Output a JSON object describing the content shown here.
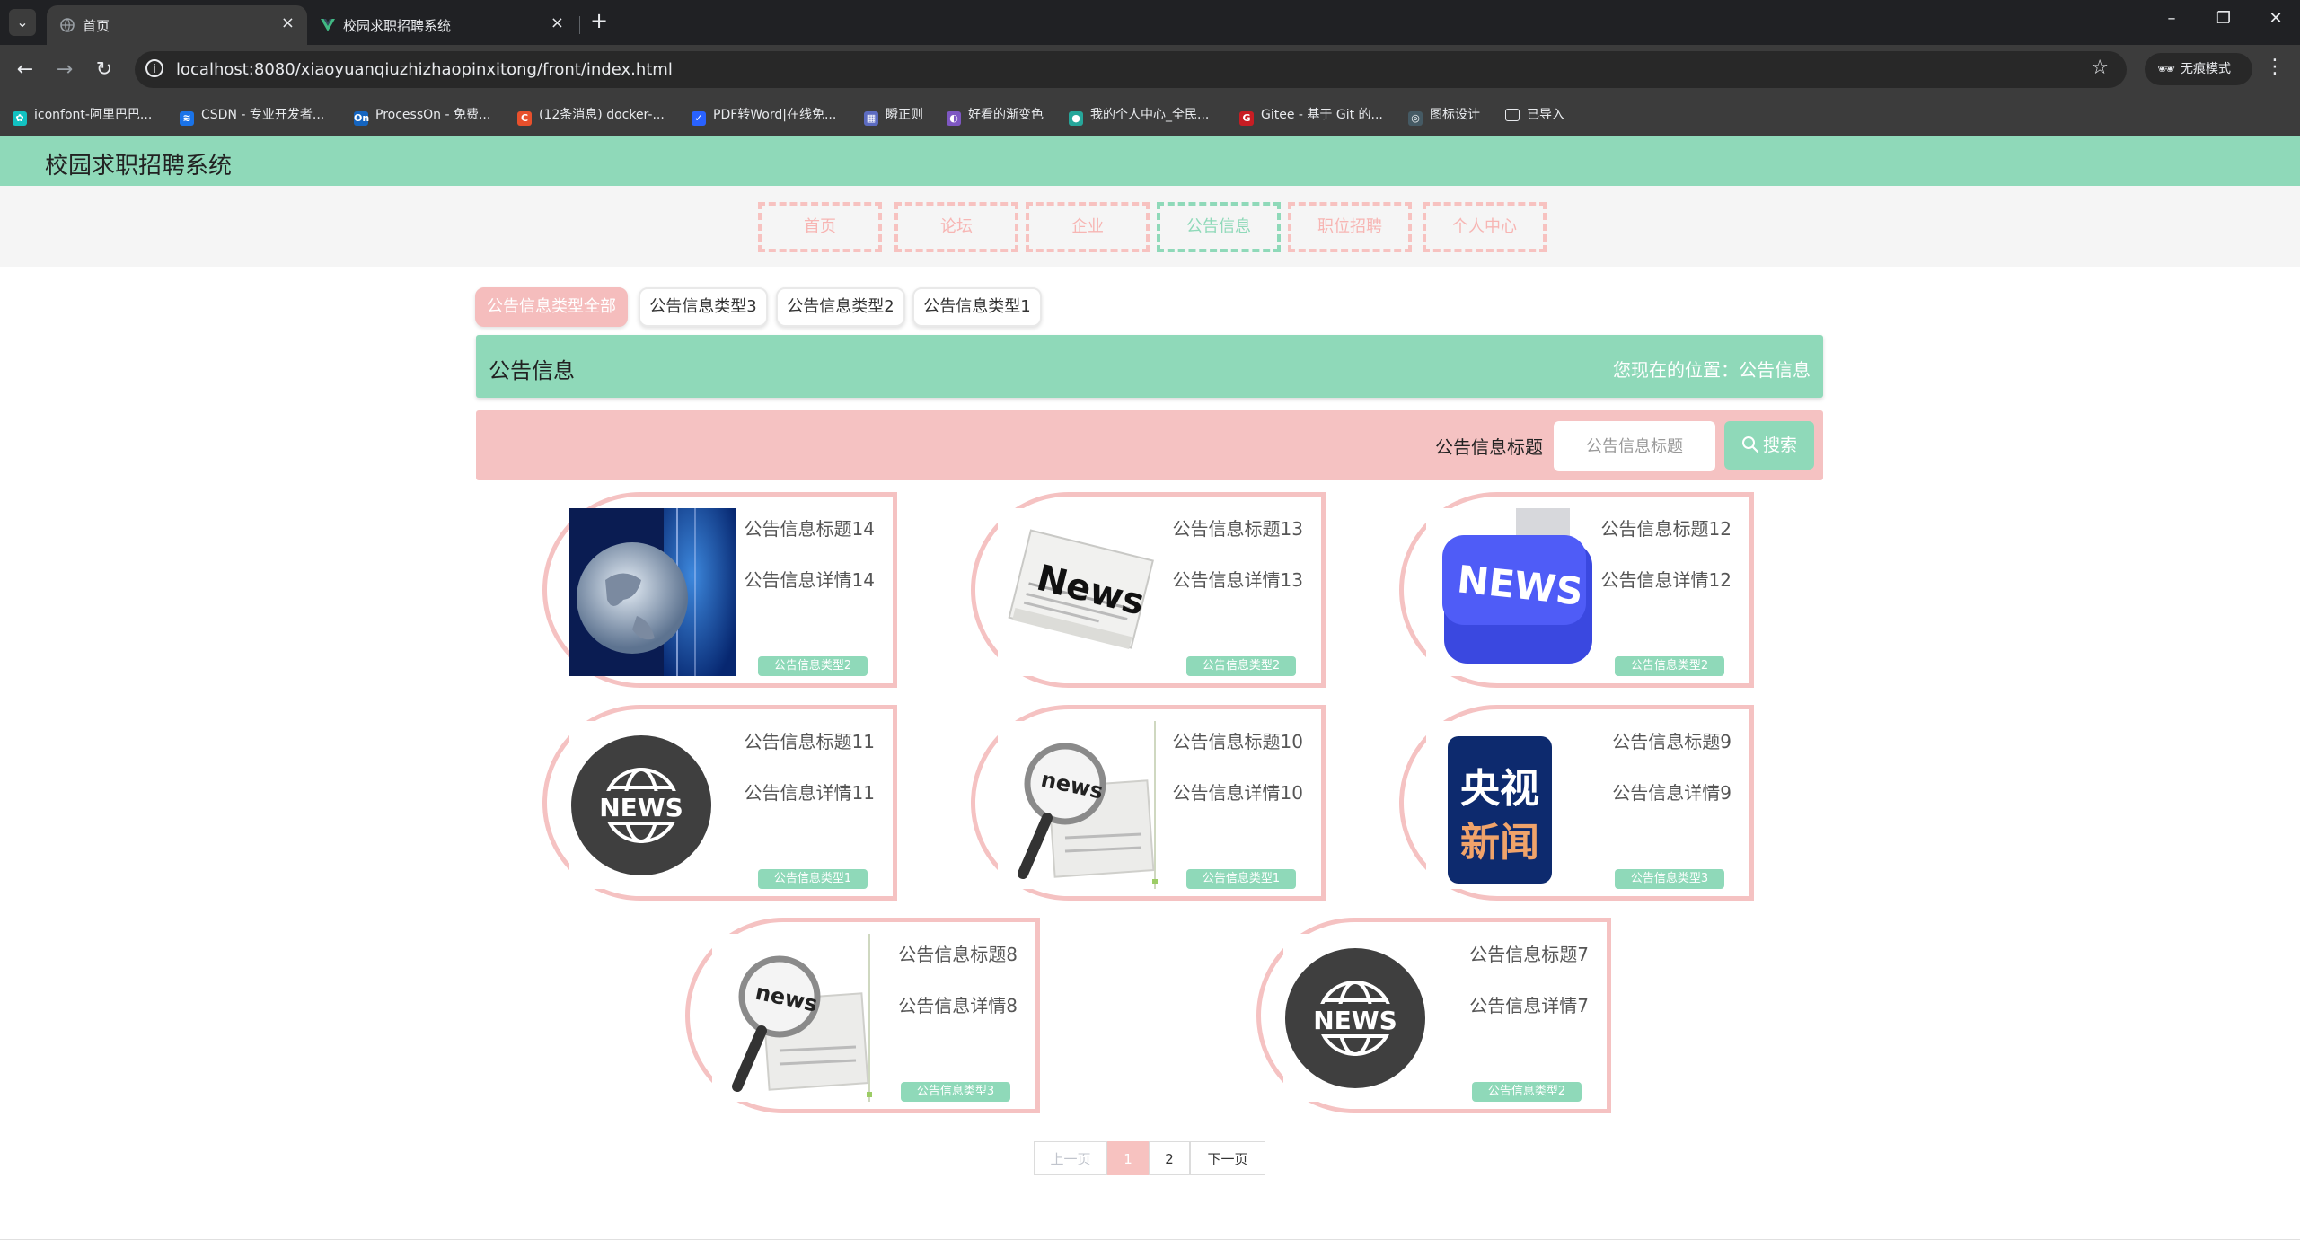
{
  "browser": {
    "tabs": [
      {
        "title": "首页",
        "active": true
      },
      {
        "title": "校园求职招聘系统",
        "active": false
      }
    ],
    "url": "localhost:8080/xiaoyuanqiuzhizhaopinxitong/front/index.html",
    "incognito_label": "无痕模式",
    "bookmarks": [
      {
        "label": "iconfont-阿里巴巴...",
        "icon": "iconfont-icon",
        "color": "#12c2c2"
      },
      {
        "label": "CSDN - 专业开发者...",
        "icon": "csdn-icon",
        "color": "#1a73e8"
      },
      {
        "label": "ProcessOn - 免费...",
        "icon": "processon-icon",
        "color": "#1565c0"
      },
      {
        "label": "(12条消息) docker-...",
        "icon": "csdn-c-icon",
        "color": "#e8502c"
      },
      {
        "label": "PDF转Word|在线免...",
        "icon": "pdf-icon",
        "color": "#2962ff"
      },
      {
        "label": "瞬正则",
        "icon": "regex-icon",
        "color": "#5c6bc0"
      },
      {
        "label": "好看的渐变色",
        "icon": "gradient-icon",
        "color": "#7e57c2"
      },
      {
        "label": "我的个人中心_全民...",
        "icon": "person-icon",
        "color": "#26a69a"
      },
      {
        "label": "Gitee - 基于 Git 的...",
        "icon": "gitee-icon",
        "color": "#c71d23"
      },
      {
        "label": "图标设计",
        "icon": "design-icon",
        "color": "#455a64"
      },
      {
        "label": "已导入",
        "icon": "folder-icon",
        "color": "#e8eaed"
      }
    ]
  },
  "site": {
    "title": "校园求职招聘系统",
    "nav": [
      {
        "label": "首页",
        "active": false
      },
      {
        "label": "论坛",
        "active": false
      },
      {
        "label": "企业",
        "active": false
      },
      {
        "label": "公告信息",
        "active": true
      },
      {
        "label": "职位招聘",
        "active": false
      },
      {
        "label": "个人中心",
        "active": false
      }
    ]
  },
  "filters": [
    {
      "label": "公告信息类型全部",
      "active": true
    },
    {
      "label": "公告信息类型3",
      "active": false
    },
    {
      "label": "公告信息类型2",
      "active": false
    },
    {
      "label": "公告信息类型1",
      "active": false
    }
  ],
  "section": {
    "title": "公告信息",
    "breadcrumb": "您现在的位置：公告信息"
  },
  "search": {
    "label": "公告信息标题",
    "placeholder": "公告信息标题",
    "button": "搜索"
  },
  "cards": [
    {
      "title": "公告信息标题14",
      "detail": "公告信息详情14",
      "type": "公告信息类型2",
      "image": "globe-news-image"
    },
    {
      "title": "公告信息标题13",
      "detail": "公告信息详情13",
      "type": "公告信息类型2",
      "image": "newspaper-news-image"
    },
    {
      "title": "公告信息标题12",
      "detail": "公告信息详情12",
      "type": "公告信息类型2",
      "image": "news-key-image"
    },
    {
      "title": "公告信息标题11",
      "detail": "公告信息详情11",
      "type": "公告信息类型1",
      "image": "news-globe-badge-image"
    },
    {
      "title": "公告信息标题10",
      "detail": "公告信息详情10",
      "type": "公告信息类型1",
      "image": "magnifier-news-image"
    },
    {
      "title": "公告信息标题9",
      "detail": "公告信息详情9",
      "type": "公告信息类型3",
      "image": "cctv-news-logo-image"
    },
    {
      "title": "公告信息标题8",
      "detail": "公告信息详情8",
      "type": "公告信息类型3",
      "image": "magnifier-news-image"
    },
    {
      "title": "公告信息标题7",
      "detail": "公告信息详情7",
      "type": "公告信息类型2",
      "image": "news-globe-badge-image"
    }
  ],
  "pagination": {
    "prev": "上一页",
    "pages": [
      "1",
      "2"
    ],
    "current": "1",
    "next": "下一页"
  },
  "colors": {
    "header_green": "#8fd9b9",
    "accent_pink": "#f5c2c2"
  }
}
